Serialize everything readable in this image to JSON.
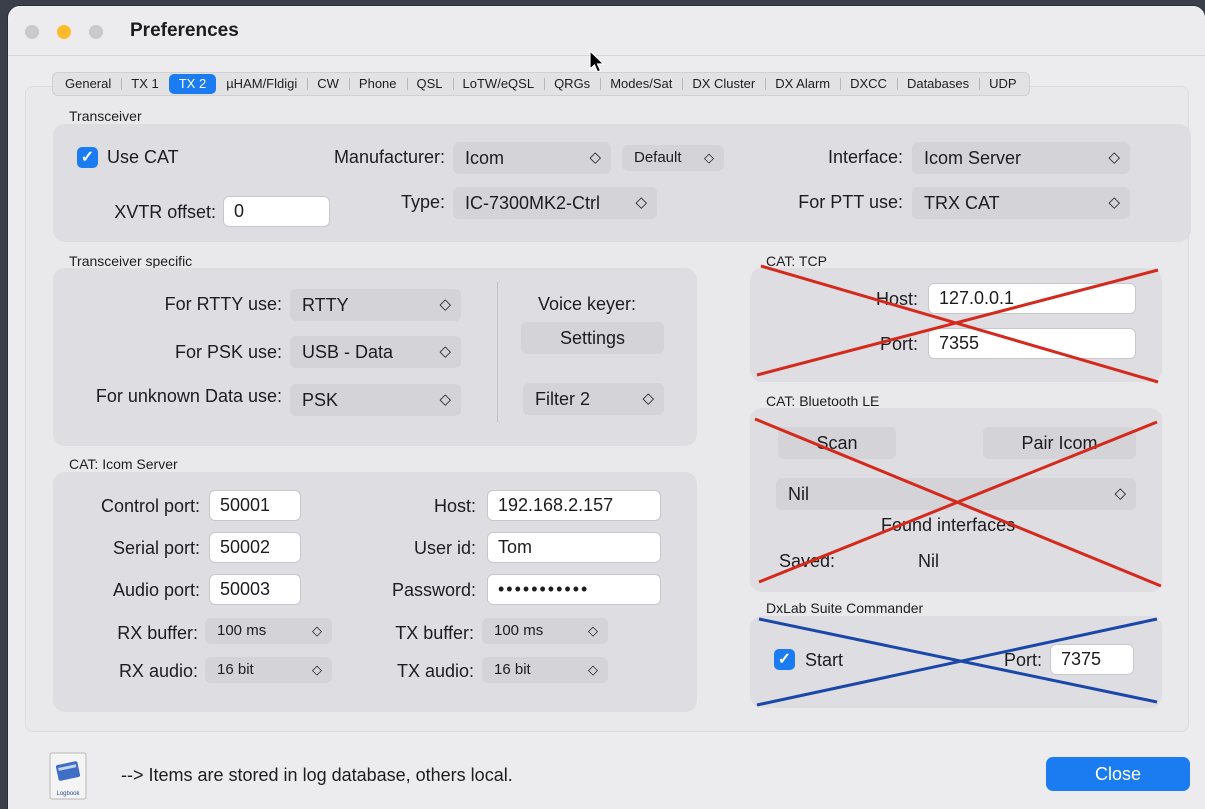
{
  "window": {
    "title": "Preferences"
  },
  "tabs": [
    "General",
    "TX 1",
    "TX 2",
    "µHAM/Fldigi",
    "CW",
    "Phone",
    "QSL",
    "LoTW/eQSL",
    "QRGs",
    "Modes/Sat",
    "DX Cluster",
    "DX Alarm",
    "DXCC",
    "Databases",
    "UDP"
  ],
  "active_tab": "TX 2",
  "transceiver": {
    "group": "Transceiver",
    "use_cat_label": "Use CAT",
    "use_cat_checked": true,
    "manufacturer_label": "Manufacturer:",
    "manufacturer_value": "Icom",
    "default_value": "Default",
    "type_label": "Type:",
    "type_value": "IC-7300MK2-Ctrl",
    "interface_label": "Interface:",
    "interface_value": "Icom Server",
    "ptt_label": "For PTT use:",
    "ptt_value": "TRX CAT",
    "xvtr_label": "XVTR offset:",
    "xvtr_value": "0"
  },
  "specific": {
    "group": "Transceiver specific",
    "rtty_label": "For RTTY use:",
    "rtty_value": "RTTY",
    "psk_label": "For PSK use:",
    "psk_value": "USB - Data",
    "unknown_label": "For unknown Data use:",
    "unknown_value": "PSK",
    "voice_label": "Voice keyer:",
    "settings_button": "Settings",
    "filter_value": "Filter 2"
  },
  "icom_server": {
    "group": "CAT: Icom Server",
    "control_port_label": "Control port:",
    "control_port": "50001",
    "serial_port_label": "Serial port:",
    "serial_port": "50002",
    "audio_port_label": "Audio port:",
    "audio_port": "50003",
    "host_label": "Host:",
    "host": "192.168.2.157",
    "user_label": "User id:",
    "user": "Tom",
    "password_label": "Password:",
    "password": "•••••••••••",
    "rx_buffer_label": "RX buffer:",
    "rx_buffer": "100 ms",
    "tx_buffer_label": "TX buffer:",
    "tx_buffer": "100 ms",
    "rx_audio_label": "RX audio:",
    "rx_audio": "16 bit",
    "tx_audio_label": "TX audio:",
    "tx_audio": "16 bit"
  },
  "cat_tcp": {
    "group": "CAT: TCP",
    "host_label": "Host:",
    "host": "127.0.0.1",
    "port_label": "Port:",
    "port": "7355"
  },
  "bluetooth": {
    "group": "CAT: Bluetooth LE",
    "scan_button": "Scan",
    "pair_button": "Pair Icom",
    "device_value": "Nil",
    "found_label": "Found interfaces",
    "saved_label": "Saved:",
    "saved_value": "Nil"
  },
  "dxlab": {
    "group": "DxLab Suite Commander",
    "start_label": "Start",
    "start_checked": true,
    "port_label": "Port:",
    "port": "7375"
  },
  "footer": {
    "note": "--> Items are stored in log database, others local.",
    "icon_label": "Logbook",
    "close_button": "Close"
  },
  "colors": {
    "accent": "#1a7cf0",
    "red_cross": "#d42a1e",
    "blue_cross": "#1a47a8"
  }
}
